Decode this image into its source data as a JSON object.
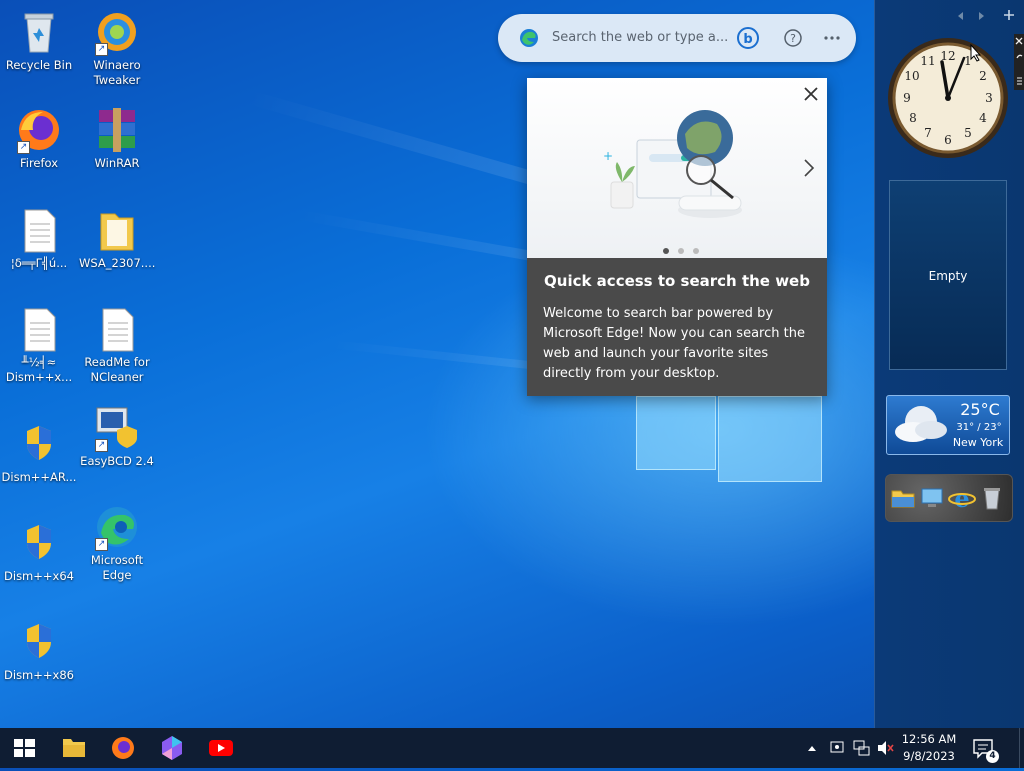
{
  "desktop": {
    "icons": [
      {
        "label": "Recycle Bin",
        "icon": "recycle-bin-icon"
      },
      {
        "label": "Winaero Tweaker",
        "icon": "winaero-tweaker-icon"
      },
      {
        "label": "Firefox",
        "icon": "firefox-icon"
      },
      {
        "label": "WinRAR",
        "icon": "winrar-icon"
      },
      {
        "label": "¦δ═╤Γ╣ú...",
        "icon": "text-file-icon"
      },
      {
        "label": "WSA_2307....",
        "icon": "folder-icon"
      },
      {
        "label": "╨½╡≈ Dism++x...",
        "icon": "text-file-icon"
      },
      {
        "label": "ReadMe for NCleaner",
        "icon": "text-file-icon"
      },
      {
        "label": "Dism++AR...",
        "icon": "uac-shield-icon"
      },
      {
        "label": "EasyBCD 2.4",
        "icon": "easybcd-icon"
      },
      {
        "label": "Dism++x64",
        "icon": "uac-shield-icon"
      },
      {
        "label": "Microsoft Edge",
        "icon": "edge-icon"
      },
      {
        "label": "Dism++x86",
        "icon": "uac-shield-icon"
      }
    ]
  },
  "searchbar": {
    "placeholder": "Search the web or type a..."
  },
  "popup": {
    "title": "Quick access to search the web",
    "body": "Welcome to search bar powered by Microsoft Edge! Now you can search the web and launch your favorite sites directly from your desktop.",
    "pages": 3,
    "active_page": 1
  },
  "sidebar": {
    "empty_gadget_label": "Empty",
    "weather": {
      "temp": "25°C",
      "range": "31° / 23°",
      "city": "New York"
    }
  },
  "taskbar": {
    "time": "12:56 AM",
    "date": "9/8/2023",
    "notification_count": "4"
  },
  "colors": {
    "taskbar": "#0f1d33",
    "sidebar": "#0b3a78",
    "popup": "#4a4a4a",
    "accent": "#0078d4"
  }
}
